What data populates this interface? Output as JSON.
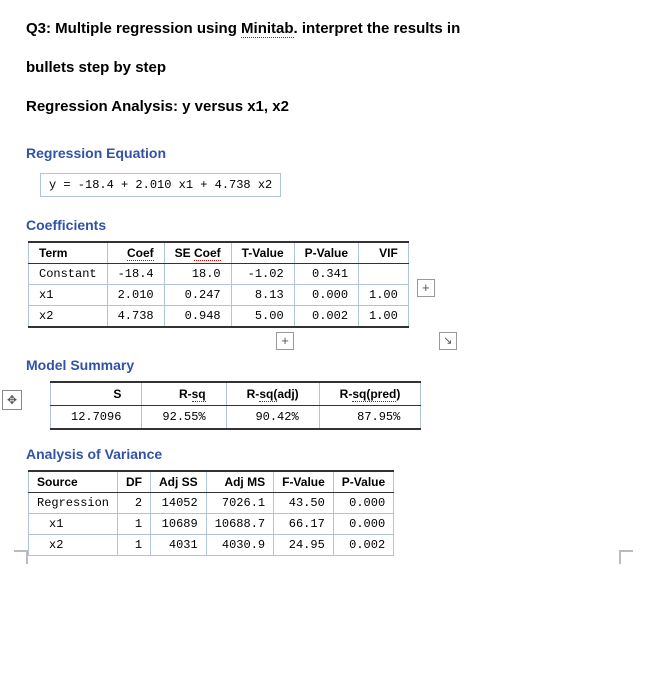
{
  "title": {
    "part1": "Q3: Multiple regression using ",
    "underlined1": "Minitab",
    "part2": ". interpret the results in",
    "line2": "bullets step by step",
    "line3": "Regression Analysis: y versus x1, x2"
  },
  "sections": {
    "equation_header": "Regression Equation",
    "coefficients_header": "Coefficients",
    "model_summary_header": "Model Summary",
    "anova_header": "Analysis of Variance"
  },
  "equation": "y = -18.4 + 2.010 x1 + 4.738 x2",
  "coeff_headers": {
    "term": "Term",
    "coef": "Coef",
    "se": "SE Coef",
    "t": "T-Value",
    "p": "P-Value",
    "vif": "VIF"
  },
  "coeff_rows": [
    {
      "term": "Constant",
      "coef": "-18.4",
      "se": "18.0",
      "t": "-1.02",
      "p": "0.341",
      "vif": ""
    },
    {
      "term": "x1",
      "coef": "2.010",
      "se": "0.247",
      "t": "8.13",
      "p": "0.000",
      "vif": "1.00"
    },
    {
      "term": "x2",
      "coef": "4.738",
      "se": "0.948",
      "t": "5.00",
      "p": "0.002",
      "vif": "1.00"
    }
  ],
  "summary_headers": {
    "s": "S",
    "rsq": "R-sq",
    "rsqadj": "R-sq(adj)",
    "rsqpred": "R-sq(pred)"
  },
  "summary_row": {
    "s": "12.7096",
    "rsq": "92.55%",
    "rsqadj": "90.42%",
    "rsqpred": "87.95%"
  },
  "anova_headers": {
    "source": "Source",
    "df": "DF",
    "adjss": "Adj SS",
    "adjms": "Adj MS",
    "f": "F-Value",
    "p": "P-Value"
  },
  "anova_rows": [
    {
      "source": "Regression",
      "df": "2",
      "adjss": "14052",
      "adjms": "7026.1",
      "f": "43.50",
      "p": "0.000"
    },
    {
      "source": "  x1",
      "df": "1",
      "adjss": "10689",
      "adjms": "10688.7",
      "f": "66.17",
      "p": "0.000"
    },
    {
      "source": "  x2",
      "df": "1",
      "adjss": "4031",
      "adjms": "4030.9",
      "f": "24.95",
      "p": "0.002"
    }
  ]
}
